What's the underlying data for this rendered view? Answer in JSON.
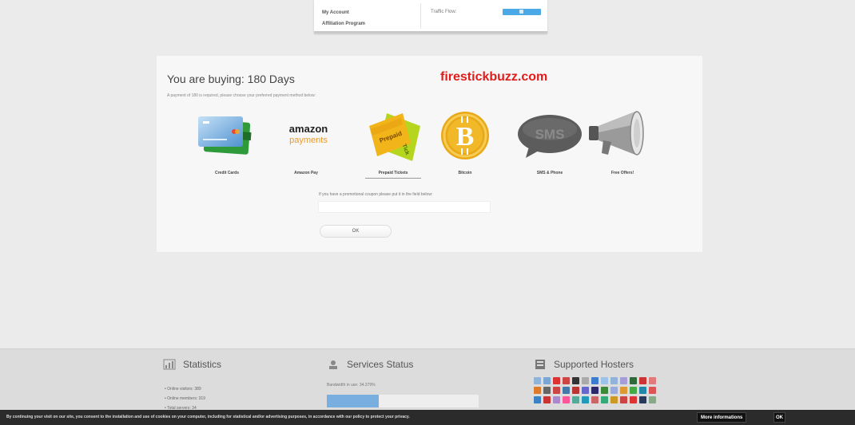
{
  "account_menu": {
    "items": [
      "My Account",
      "Affiliation Program"
    ],
    "traffic_label": "Traffic Flow:"
  },
  "purchase": {
    "title": "You are buying: 180 Days",
    "watermark": "firestickbuzz.com",
    "subtitle": "A payment of 180 is required, please choose your preferred payment method below:",
    "methods": [
      {
        "label": "Credit Cards",
        "icon": "credit-card-icon"
      },
      {
        "label": "Amazon Pay",
        "icon": "amazon-payments-logo",
        "logo_line1": "amazon",
        "logo_line2": "payments"
      },
      {
        "label": "Prepaid Tickets",
        "icon": "prepaid-ticket-icon"
      },
      {
        "label": "Bitcoin",
        "icon": "bitcoin-icon"
      },
      {
        "label": "SMS & Phone",
        "icon": "sms-bubble-icon",
        "bubble_text": "SMS"
      },
      {
        "label": "Free Offers!",
        "icon": "megaphone-icon"
      }
    ],
    "promo_text": "If you have a promotional coupon please put it in the field below:",
    "promo_value": "",
    "ok_label": "OK"
  },
  "footer": {
    "statistics": {
      "title": "Statistics",
      "items": [
        "Online visitors: 389",
        "Online members: 319",
        "Total servers: 34"
      ]
    },
    "services": {
      "title": "Services Status",
      "bandwidth": "Bandwidth in use: 34.379%",
      "bandwidth_percent": 34.379
    },
    "hosters": {
      "title": "Supported Hosters",
      "colors": [
        "#8fb3d9",
        "#7aa6d6",
        "#d33",
        "#c44",
        "#333",
        "#aaa",
        "#3c7ccf",
        "#9bc2e8",
        "#8fb3d9",
        "#a59ed6",
        "#2f6a3a",
        "#c33",
        "#e27a7a",
        "#e07a2b",
        "#666",
        "#c44",
        "#47a",
        "#b33",
        "#66c",
        "#2a2a6a",
        "#3a8a3a",
        "#9ad",
        "#d93",
        "#4a4",
        "#28a",
        "#d55",
        "#3b82c4",
        "#c33",
        "#a8c",
        "#f59",
        "#5a9",
        "#29b",
        "#c66",
        "#3a7",
        "#c92",
        "#c44",
        "#d33",
        "#2a3a5a",
        "#8a8"
      ]
    }
  },
  "cookie": {
    "text": "By continuing your visit on our site, you consent to the installation and use of cookies on your computer, including for statistical and/or advertising purposes, in accordance with our policy to protect your privacy.",
    "more_label": "More informations",
    "ok_label": "OK"
  },
  "colors": {
    "brand_red": "#e21b1b",
    "progress_blue": "#78aee0",
    "cookie_bg": "#2b2b2b"
  }
}
